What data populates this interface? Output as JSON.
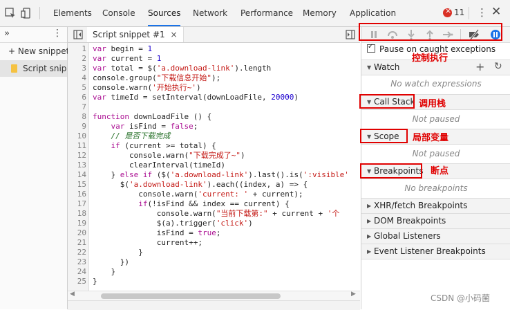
{
  "devtools": {
    "tabs": [
      "Elements",
      "Console",
      "Sources",
      "Network",
      "Performance",
      "Memory",
      "Application"
    ],
    "active_tab": "Sources",
    "error_count": "11"
  },
  "navigator": {
    "new_snippet": "+ New snippet",
    "snippet_item": "Script snipp"
  },
  "editor": {
    "tab_label": "Script snippet #1",
    "close_glyph": "×",
    "lines": [
      "var begin = 1",
      "var current = 1",
      "var total = $('a.download-link').length",
      "console.group(\"下载信息开始\");",
      "console.warn('开始执行~')",
      "var timeId = setInterval(downLoadFile, 20000)",
      "",
      "function downLoadFile () {",
      "    var isFind = false;",
      "    // 是否下载完成",
      "    if (current >= total) {",
      "        console.warn(\"下载完成了~\")",
      "        clearInterval(timeId)",
      "    } else if ($('a.download-link').last().is(':visible'",
      "      $('a.download-link').each((index, a) => {",
      "          console.warn('current: ' + current);",
      "          if(!isFind && index == current) {",
      "              console.warn(\"当前下载第:\" + current + '个",
      "              $(a).trigger('click')",
      "              isFind = true;",
      "              current++;",
      "          }",
      "      })",
      "    }",
      "}"
    ]
  },
  "debugger": {
    "pause_on_exceptions": "Pause on caught exceptions",
    "sections": [
      {
        "name": "Watch",
        "empty": "No watch expressions"
      },
      {
        "name": "Call Stack",
        "empty": "Not paused"
      },
      {
        "name": "Scope",
        "empty": "Not paused"
      },
      {
        "name": "Breakpoints",
        "empty": "No breakpoints"
      }
    ],
    "extra_sections": [
      "XHR/fetch Breakpoints",
      "DOM Breakpoints",
      "Global Listeners",
      "Event Listener Breakpoints"
    ]
  },
  "annotations": {
    "controls": "控制执行",
    "call_stack": "调用栈",
    "scope": "局部变量",
    "breakpoints": "断点"
  },
  "watermark": "CSDN @小码菌",
  "colors": {
    "accent": "#1a73e8",
    "annotation_red": "#e00000",
    "error_red": "#d93025"
  }
}
